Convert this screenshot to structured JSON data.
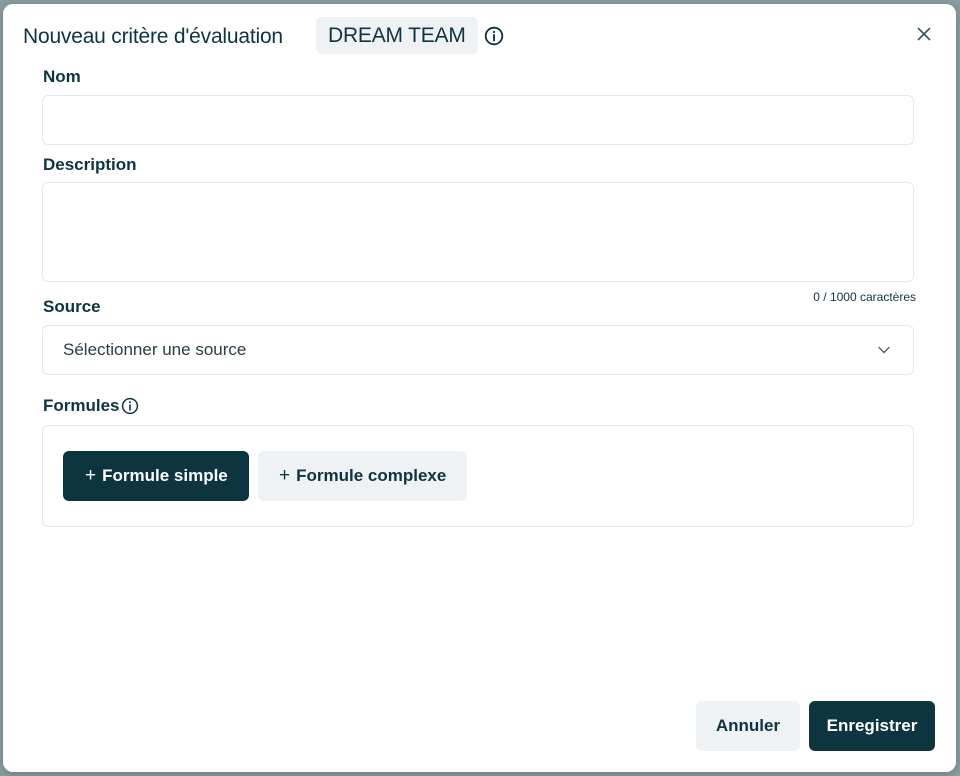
{
  "dialog": {
    "title": "Nouveau critère d'évaluation",
    "team_badge": "DREAM TEAM",
    "close_label": "×"
  },
  "form": {
    "name_label": "Nom",
    "name_value": "",
    "description_label": "Description",
    "description_value": "",
    "char_count": "0 / 1000 caractères",
    "source_label": "Source",
    "source_placeholder": "Sélectionner une source",
    "formules_label": "Formules"
  },
  "formules": {
    "simple_label": "Formule simple",
    "complex_label": "Formule complexe",
    "plus_glyph": "+"
  },
  "footer": {
    "cancel_label": "Annuler",
    "save_label": "Enregistrer"
  },
  "colors": {
    "primary": "#0e3440",
    "light_button": "#eef2f5",
    "border": "#e3e8ec"
  }
}
